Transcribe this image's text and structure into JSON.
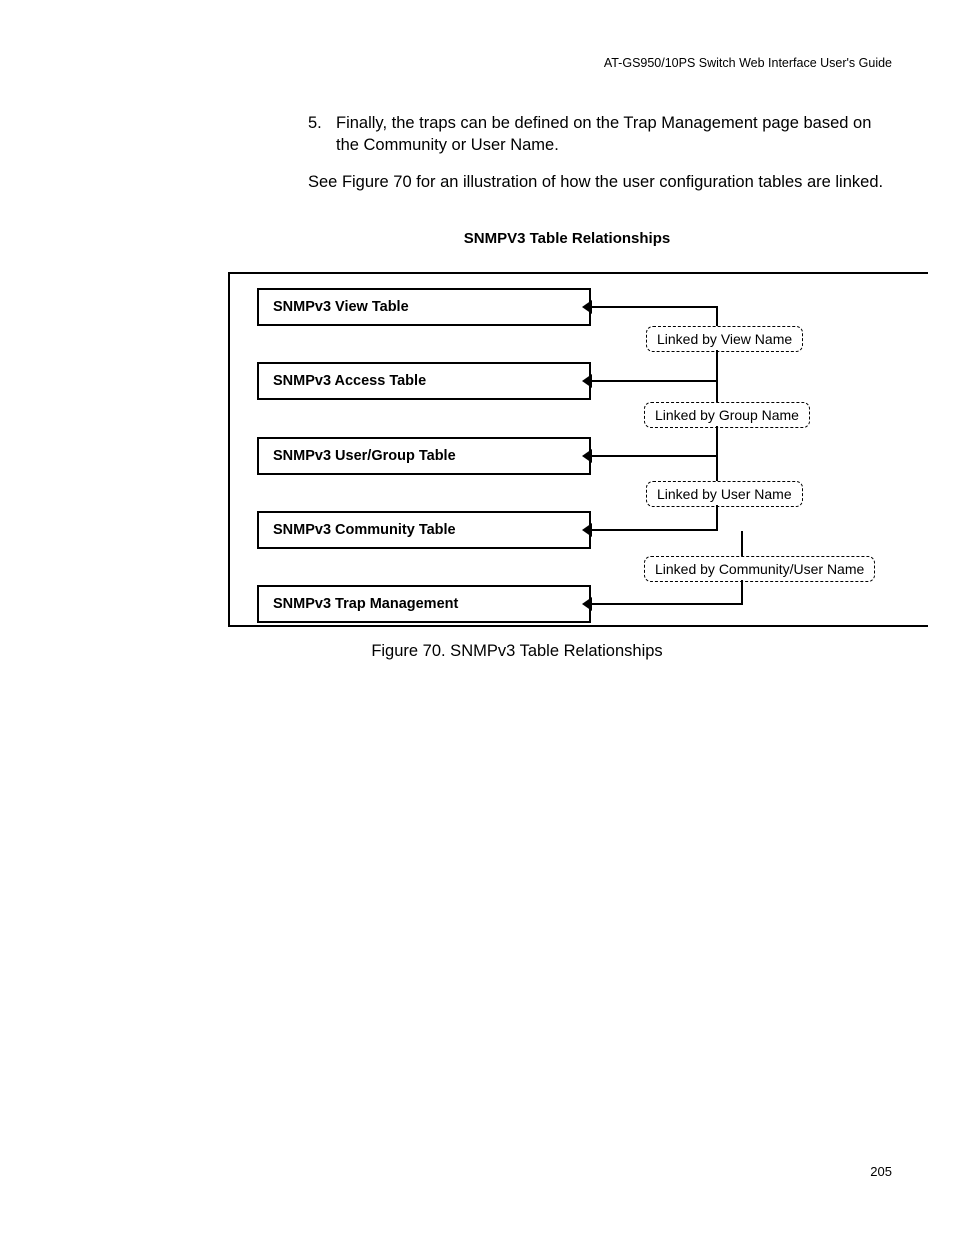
{
  "header": {
    "guideTitle": "AT-GS950/10PS Switch Web Interface User's Guide"
  },
  "content": {
    "stepNumber": "5.",
    "stepText": "Finally, the traps can be defined on the Trap Management page based on the Community or User Name.",
    "referenceText": "See Figure 70 for an illustration of how the user configuration tables are linked."
  },
  "diagram": {
    "title": "SNMPV3 Table Relationships",
    "tables": {
      "view": "SNMPv3 View Table",
      "access": "SNMPv3 Access Table",
      "userGroup": "SNMPv3 User/Group Table",
      "community": "SNMPv3 Community Table",
      "trap": "SNMPv3 Trap Management"
    },
    "links": {
      "viewName": "Linked by View Name",
      "groupName": "Linked by Group Name",
      "userName": "Linked by User Name",
      "communityUserName": "Linked by Community/User Name"
    }
  },
  "figureCaption": "Figure 70. SNMPv3 Table Relationships",
  "pageNumber": "205"
}
